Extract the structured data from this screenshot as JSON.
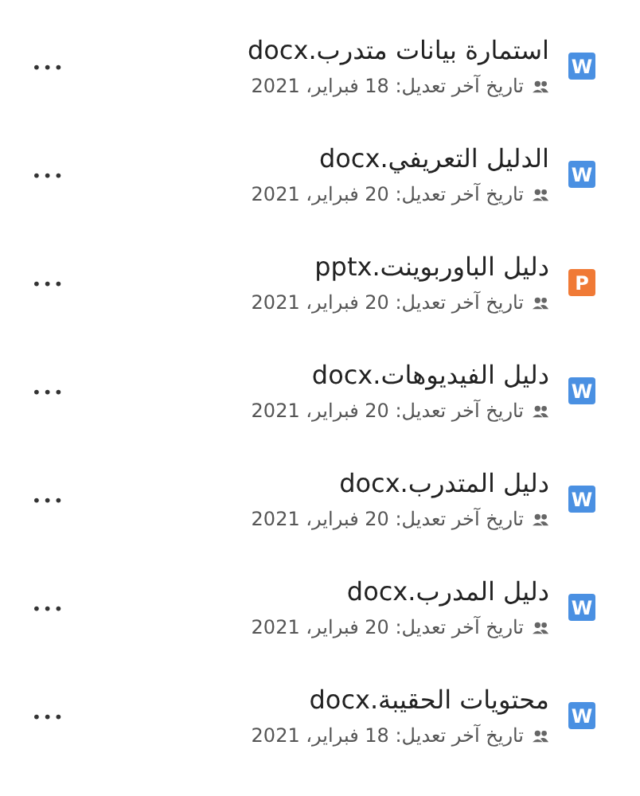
{
  "files": [
    {
      "name": "استمارة بيانات متدرب.docx",
      "modified": "تاريخ آخر تعديل: 18 فبراير، 2021",
      "kind": "word",
      "badge": "W",
      "more": "•••"
    },
    {
      "name": "الدليل التعريفي.docx",
      "modified": "تاريخ آخر تعديل: 20 فبراير، 2021",
      "kind": "word",
      "badge": "W",
      "more": "•••"
    },
    {
      "name": "دليل الباوربوينت.pptx",
      "modified": "تاريخ آخر تعديل: 20 فبراير، 2021",
      "kind": "powerpoint",
      "badge": "P",
      "more": "•••"
    },
    {
      "name": "دليل الفيديوهات.docx",
      "modified": "تاريخ آخر تعديل: 20 فبراير، 2021",
      "kind": "word",
      "badge": "W",
      "more": "•••"
    },
    {
      "name": "دليل المتدرب.docx",
      "modified": "تاريخ آخر تعديل: 20 فبراير، 2021",
      "kind": "word",
      "badge": "W",
      "more": "•••"
    },
    {
      "name": "دليل المدرب.docx",
      "modified": "تاريخ آخر تعديل: 20 فبراير، 2021",
      "kind": "word",
      "badge": "W",
      "more": "•••"
    },
    {
      "name": "محتويات الحقيبة.docx",
      "modified": "تاريخ آخر تعديل: 18 فبراير، 2021",
      "kind": "word",
      "badge": "W",
      "more": "•••"
    }
  ]
}
